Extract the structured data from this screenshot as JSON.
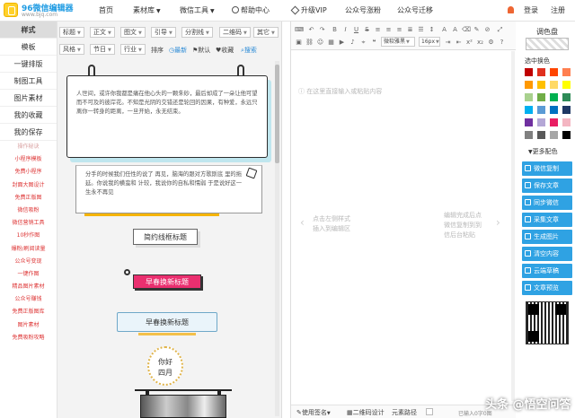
{
  "nav": {
    "logo_name": "96微信编辑器",
    "logo_url": "www.bjq.com",
    "items": [
      {
        "label": "首页"
      },
      {
        "label": "素材库"
      },
      {
        "label": "微信工具"
      },
      {
        "label": "帮助中心"
      },
      {
        "label": "升级VIP"
      },
      {
        "label": "公众号涨粉"
      },
      {
        "label": "公众号迁移"
      }
    ],
    "login": "登录",
    "register": "注册"
  },
  "sidebar": {
    "main": [
      "样式",
      "模板",
      "一键排版",
      "制图工具",
      "图片素材",
      "我的收藏",
      "我的保存"
    ],
    "sub": [
      "操作秘诀",
      "小程序模板",
      "免费小程序",
      "封面大图设计",
      "免费正版图",
      "微信吸粉",
      "微信营销工具",
      "10秒作图",
      "爆粉/刷阅读量",
      "公众号变现",
      "一键作图",
      "精品图片素材",
      "公众号赚钱",
      "免费正版图库",
      "图片素材",
      "免费吸粉攻略"
    ]
  },
  "styles": {
    "row1": [
      {
        "label": "标题"
      },
      {
        "label": "正文"
      },
      {
        "label": "图文"
      },
      {
        "label": "引导"
      },
      {
        "label": "分割线"
      },
      {
        "label": "二维码"
      },
      {
        "label": "其它"
      }
    ],
    "row2": [
      {
        "label": "风格"
      },
      {
        "label": "节日"
      },
      {
        "label": "行业"
      }
    ],
    "sort": "排序",
    "latest": "最新",
    "default": "默认",
    "favorite": "收藏",
    "search": "搜索",
    "card1_text": "人世间，或许你我都是痛在他心头的一颗朱砂，最后却成了一朵让他可望而不可及的彼岸花。不知是光阴的交错还是轮回的因果，有种爱，永远只离你一转身的距离，一旦开始，永无结束。",
    "card2_text": "分手的时候我们任性的说了 再见，脑海的跟对方歌斯底 里的拖延。你说我的横蛮和 计较，我说你的自私和懦弱 于是说好这一生永不再见",
    "title1": "简约线框标题",
    "title2": "早春换新标题",
    "title3": "早春换新标题",
    "badge_line1": "你好",
    "badge_line2": "四月"
  },
  "editor": {
    "font": "微软雅黑",
    "size": "16px",
    "placeholder_top": "在这里直接输入或粘贴内容",
    "placeholder_left_1": "点击左侧样式",
    "placeholder_left_2": "插入到编辑区",
    "placeholder_right_1": "编辑完成后点",
    "placeholder_right_2": "微信复制到到",
    "placeholder_right_3": "信后台粘贴",
    "status_sign": "使用签名",
    "status_qr": "二维码设计",
    "status_path": "元素路径",
    "char_count": "已输入0字0图"
  },
  "right": {
    "palette_title": "调色盘",
    "select_swap": "选中换色",
    "more_colors": "更多配色",
    "actions": [
      {
        "label": "微信复制"
      },
      {
        "label": "保存文章"
      },
      {
        "label": "同步微信"
      },
      {
        "label": "采集文章"
      },
      {
        "label": "生成图片"
      },
      {
        "label": "清空内容"
      },
      {
        "label": "云端草稿"
      },
      {
        "label": "文章预览"
      }
    ]
  },
  "colors": {
    "accent": "#2fa2e3",
    "palette": [
      "#c00000",
      "#e0301e",
      "#ff4500",
      "#ff7f50",
      "#ff9900",
      "#ffc000",
      "#ffd966",
      "#ffff00",
      "#a9d18e",
      "#70ad47",
      "#00b050",
      "#2e8b57",
      "#00b0f0",
      "#5b9bd5",
      "#0070c0",
      "#1f3864",
      "#7030a0",
      "#b4a7d6",
      "#e91e63",
      "#f4b6c2",
      "#808080",
      "#595959",
      "#a6a6a6",
      "#000000"
    ]
  },
  "watermark": "头条 @悟空问答"
}
